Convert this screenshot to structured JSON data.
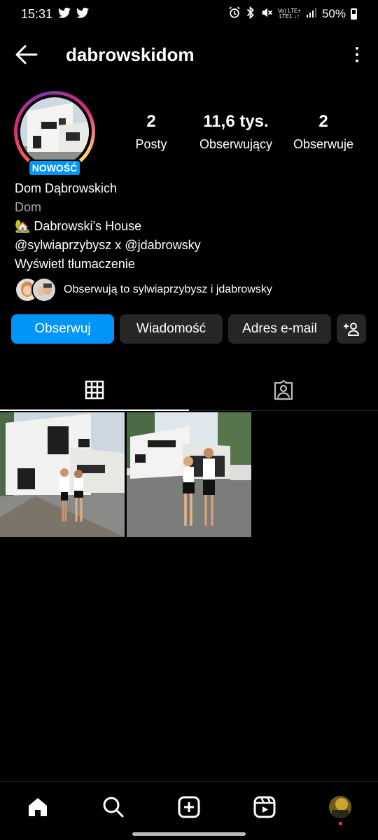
{
  "status_bar": {
    "time": "15:31",
    "network_top": "Vo) LTE+",
    "network_bottom": "LTE1 ↓↑",
    "battery": "50%",
    "icons": [
      "twitter-icon",
      "twitter-icon",
      "alarm-icon",
      "bluetooth-icon",
      "mute-icon",
      "signal-icon",
      "battery-icon"
    ]
  },
  "header": {
    "username": "dabrowskidom",
    "back_icon": "arrow-left-icon",
    "more_icon": "vertical-dots-icon"
  },
  "profile": {
    "badge": "NOWOŚĆ",
    "stats": [
      {
        "value": "2",
        "label": "Posty"
      },
      {
        "value": "11,6 tys.",
        "label": "Obserwujący"
      },
      {
        "value": "2",
        "label": "Obserwuje"
      }
    ],
    "name": "Dom Dąbrowskich",
    "category": "Dom",
    "bio_line1": "🏡 Dabrowski’s House",
    "bio_line2": "@sylwiaprzybysz x @jdabrowsky",
    "translate": "Wyświetl tłumaczenie",
    "followed_by": "Obserwują to sylwiaprzybysz i jdabrowsky"
  },
  "actions": {
    "follow": "Obserwuj",
    "message": "Wiadomość",
    "email": "Adres e-mail",
    "suggest_icon": "add-person-icon"
  },
  "tabs": [
    {
      "icon": "grid-icon",
      "active": true
    },
    {
      "icon": "tagged-person-icon",
      "active": false
    }
  ],
  "bottom_nav": [
    "home-icon",
    "search-icon",
    "create-post-icon",
    "reels-icon",
    "profile-avatar"
  ],
  "colors": {
    "accent": "#0095f6",
    "button_bg": "#262626",
    "secondary_text": "#a8a8a8"
  }
}
